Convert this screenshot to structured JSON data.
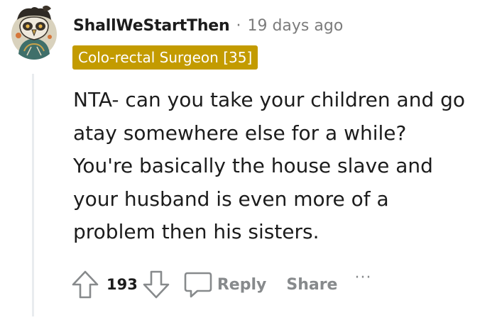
{
  "comment": {
    "username": "ShallWeStartThen",
    "separator": "·",
    "timestamp": "19 days ago",
    "flair": "Colo-rectal Surgeon [35]",
    "body_lines": [
      "NTA- can you take your children and go",
      "atay somewhere else for a while?",
      "You're basically the house slave and",
      "your husband is even more of a",
      "problem then his sisters."
    ],
    "avatar_icon": "owl-avatar-icon"
  },
  "actions": {
    "upvote_icon": "upvote-arrow-icon",
    "score": "193",
    "downvote_icon": "downvote-arrow-icon",
    "reply_icon": "speech-bubble-icon",
    "reply_label": "Reply",
    "share_label": "Share",
    "more_label": "···"
  },
  "colors": {
    "flair_bg": "#c39b00",
    "flair_text": "#ffffff",
    "muted_text": "#878a8c",
    "thread_line": "#e9ecef"
  }
}
